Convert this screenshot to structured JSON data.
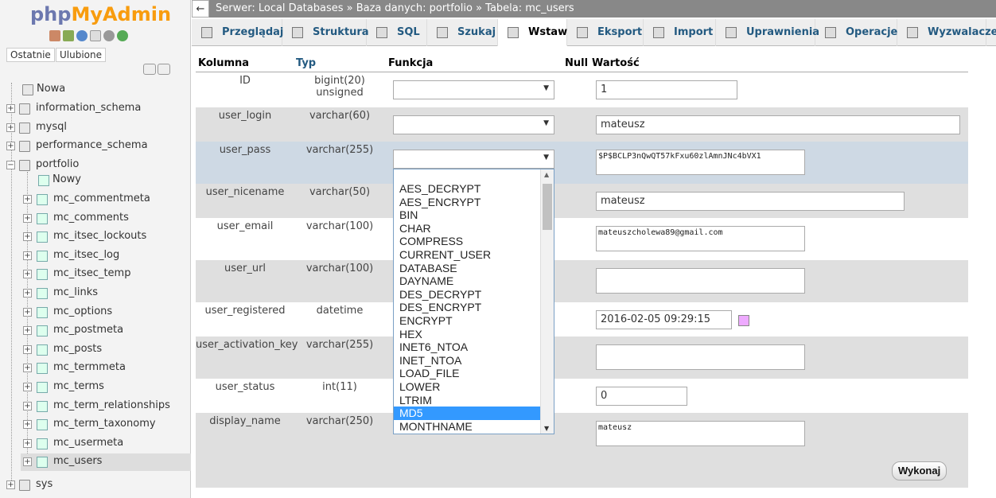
{
  "sidebar": {
    "logo_php": "php",
    "logo_ma": "MyAdmin",
    "recent_label": "Ostatnie",
    "favorites_label": "Ulubione",
    "new_label": "Nowa",
    "databases": [
      "information_schema",
      "mysql",
      "performance_schema",
      "portfolio"
    ],
    "new_table_label": "Nowy",
    "tables": [
      "mc_commentmeta",
      "mc_comments",
      "mc_itsec_lockouts",
      "mc_itsec_log",
      "mc_itsec_temp",
      "mc_links",
      "mc_options",
      "mc_postmeta",
      "mc_posts",
      "mc_termmeta",
      "mc_terms",
      "mc_term_relationships",
      "mc_term_taxonomy",
      "mc_usermeta",
      "mc_users"
    ],
    "last_db": "sys"
  },
  "breadcrumb": {
    "back": "←",
    "server": "Serwer: Local Databases »",
    "database": "Baza danych: portfolio »",
    "table": "Tabela: mc_users"
  },
  "tabs": [
    "Przeglądaj",
    "Struktura",
    "SQL",
    "Szukaj",
    "Wstaw",
    "Eksport",
    "Import",
    "Uprawnienia",
    "Operacje",
    "Wyzwalacze"
  ],
  "headers": {
    "column": "Kolumna",
    "type": "Typ",
    "function": "Funkcja",
    "null": "Null",
    "value": "Wartość"
  },
  "rows": [
    {
      "name": "ID",
      "type": "bigint(20) unsigned",
      "value": "1"
    },
    {
      "name": "user_login",
      "type": "varchar(60)",
      "value": "mateusz"
    },
    {
      "name": "user_pass",
      "type": "varchar(255)",
      "value": "$P$BCLP3nQwQT57kFxu60zlAmnJNc4bVX1"
    },
    {
      "name": "user_nicename",
      "type": "varchar(50)",
      "value": "mateusz"
    },
    {
      "name": "user_email",
      "type": "varchar(100)",
      "value": "mateuszcholewa89@gmail.com"
    },
    {
      "name": "user_url",
      "type": "varchar(100)",
      "value": ""
    },
    {
      "name": "user_registered",
      "type": "datetime",
      "value": "2016-02-05 09:29:15"
    },
    {
      "name": "user_activation_key",
      "type": "varchar(255)",
      "value": ""
    },
    {
      "name": "user_status",
      "type": "int(11)",
      "value": "0"
    },
    {
      "name": "display_name",
      "type": "varchar(250)",
      "value": "mateusz"
    }
  ],
  "function_options": [
    "AES_DECRYPT",
    "AES_ENCRYPT",
    "BIN",
    "CHAR",
    "COMPRESS",
    "CURRENT_USER",
    "DATABASE",
    "DAYNAME",
    "DES_DECRYPT",
    "DES_ENCRYPT",
    "ENCRYPT",
    "HEX",
    "INET6_NTOA",
    "INET_NTOA",
    "LOAD_FILE",
    "LOWER",
    "LTRIM",
    "MD5",
    "MONTHNAME"
  ],
  "selected_function": "MD5",
  "go_button": "Wykonaj",
  "colors": {
    "accent": "#235a81",
    "highlight": "#3399ff",
    "row_alt": "#dfdfdf",
    "row_hl": "#ced9e4"
  }
}
